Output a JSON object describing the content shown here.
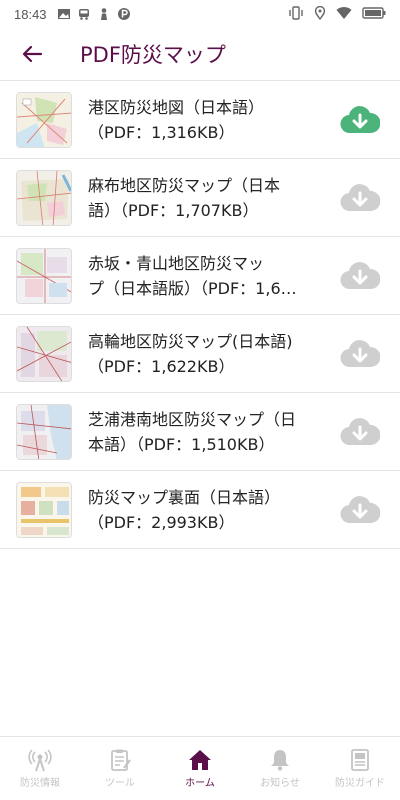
{
  "status_bar": {
    "time": "18:43"
  },
  "app_bar": {
    "title": "PDF防災マップ"
  },
  "maps": [
    {
      "line1": "港区防災地図（日本語）",
      "line2": "（PDF：1,316KB）",
      "downloaded": true
    },
    {
      "line1": "麻布地区防災マップ（日本",
      "line2": "語）（PDF：1,707KB）",
      "downloaded": false
    },
    {
      "line1": "赤坂・青山地区防災マッ",
      "line2": "プ（日本語版）（PDF：1,6…",
      "downloaded": false
    },
    {
      "line1": "高輪地区防災マップ(日本語)",
      "line2": "（PDF：1,622KB）",
      "downloaded": false
    },
    {
      "line1": "芝浦港南地区防災マップ（日",
      "line2": "本語）（PDF：1,510KB）",
      "downloaded": false
    },
    {
      "line1": "防災マップ裏面（日本語）",
      "line2": "（PDF：2,993KB）",
      "downloaded": false
    }
  ],
  "tabs": [
    {
      "label": "防災情報",
      "icon": "antenna-icon",
      "active": false
    },
    {
      "label": "ツール",
      "icon": "clipboard-icon",
      "active": false
    },
    {
      "label": "ホーム",
      "icon": "home-icon",
      "active": true
    },
    {
      "label": "お知らせ",
      "icon": "bell-icon",
      "active": false
    },
    {
      "label": "防災ガイド",
      "icon": "guide-book-icon",
      "active": false
    }
  ],
  "colors": {
    "brand": "#5a0f4a",
    "download_done": "#4cb37a",
    "download_idle": "#cfcfcf",
    "inactive_tab": "#c4c4c4"
  }
}
